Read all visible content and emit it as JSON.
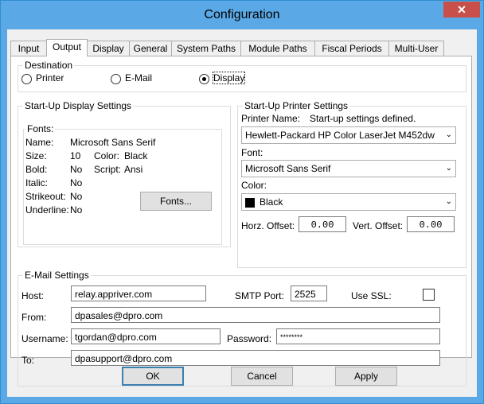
{
  "window": {
    "title": "Configuration",
    "close_glyph": "✕"
  },
  "tabs": [
    {
      "label": "Input"
    },
    {
      "label": "Output"
    },
    {
      "label": "Display"
    },
    {
      "label": "General"
    },
    {
      "label": "System Paths"
    },
    {
      "label": "Module Paths"
    },
    {
      "label": "Fiscal Periods"
    },
    {
      "label": "Multi-User"
    }
  ],
  "active_tab": "Output",
  "destination": {
    "legend": "Destination",
    "options": [
      {
        "label": "Printer",
        "checked": false
      },
      {
        "label": "E-Mail",
        "checked": false
      },
      {
        "label": "Display",
        "checked": true
      }
    ]
  },
  "startup_display": {
    "legend": "Start-Up Display Settings",
    "fonts_legend": "Fonts:",
    "name_label": "Name:",
    "name_value": "Microsoft Sans Serif",
    "size_label": "Size:",
    "size_value": "10",
    "color_label": "Color:",
    "color_value": "Black",
    "bold_label": "Bold:",
    "bold_value": "No",
    "script_label": "Script:",
    "script_value": "Ansi",
    "italic_label": "Italic:",
    "italic_value": "No",
    "strikeout_label": "Strikeout:",
    "strikeout_value": "No",
    "underline_label": "Underline:",
    "underline_value": "No",
    "fonts_button": "Fonts..."
  },
  "startup_printer": {
    "legend": "Start-Up Printer Settings",
    "printer_name_label": "Printer Name:",
    "printer_status": "Start-up settings defined.",
    "printer_value": "Hewlett-Packard HP Color LaserJet M452dw",
    "font_label": "Font:",
    "font_value": "Microsoft Sans Serif",
    "color_label": "Color:",
    "color_value": "Black",
    "horz_label": "Horz. Offset:",
    "horz_value": "0.00",
    "vert_label": "Vert. Offset:",
    "vert_value": "0.00"
  },
  "email": {
    "legend": "E-Mail Settings",
    "host_label": "Host:",
    "host_value": "relay.appriver.com",
    "smtp_label": "SMTP Port:",
    "smtp_value": "2525",
    "ssl_label": "Use SSL:",
    "ssl_checked": false,
    "from_label": "From:",
    "from_value": "dpasales@dpro.com",
    "username_label": "Username:",
    "username_value": "tgordan@dpro.com",
    "password_label": "Password:",
    "password_value": "********",
    "to_label": "To:",
    "to_value": "dpasupport@dpro.com"
  },
  "buttons": {
    "ok": "OK",
    "cancel": "Cancel",
    "apply": "Apply"
  },
  "colors": {
    "title_bar": "#5aa9e6",
    "close": "#c7504b",
    "dialog_bg": "#f0f0f0"
  }
}
